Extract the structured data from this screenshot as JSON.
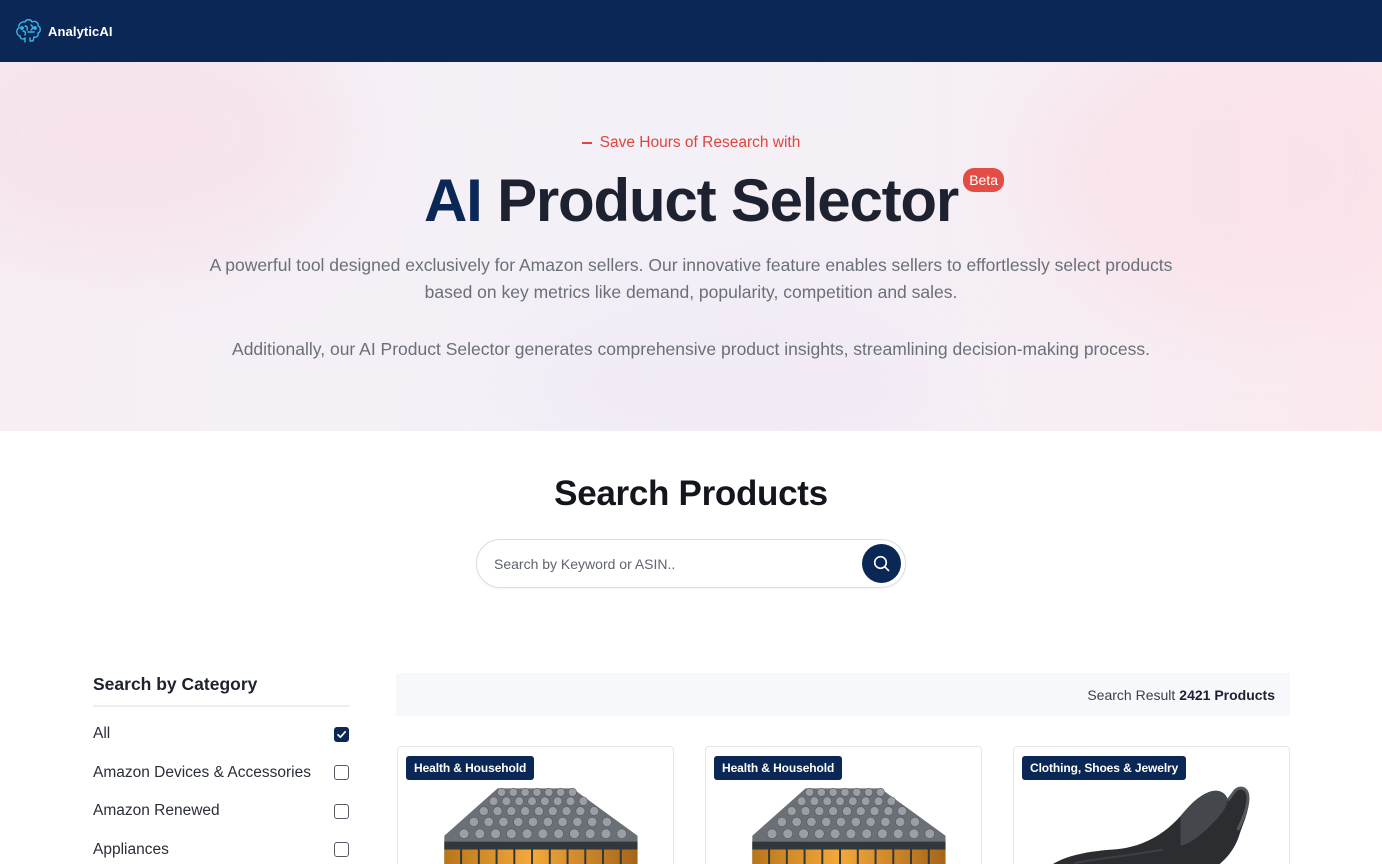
{
  "nav": {
    "brand_name": "AnalyticAI",
    "logo_icon": "brain-logo-icon"
  },
  "hero": {
    "tagline": "Save Hours of Research with",
    "title_accent": "AI",
    "title_rest": "Product Selector",
    "badge": "Beta",
    "description_1": "A powerful tool designed exclusively for Amazon sellers. Our innovative feature enables sellers to effortlessly select products based on key metrics like demand, popularity, competition and sales.",
    "description_2": "Additionally, our AI Product Selector generates comprehensive product insights, streamlining decision-making process."
  },
  "search": {
    "title": "Search Products",
    "placeholder": "Search by Keyword or ASIN..",
    "button_icon": "search-icon"
  },
  "sidebar": {
    "title": "Search by Category",
    "items": [
      {
        "label": "All",
        "checked": true
      },
      {
        "label": "Amazon Devices & Accessories",
        "checked": false
      },
      {
        "label": "Amazon Renewed",
        "checked": false
      },
      {
        "label": "Appliances",
        "checked": false
      }
    ]
  },
  "results": {
    "label": "Search Result",
    "count": "2421 Products"
  },
  "products": [
    {
      "category": "Health & Household",
      "image": "batteries-image"
    },
    {
      "category": "Health & Household",
      "image": "batteries-image"
    },
    {
      "category": "Clothing, Shoes & Jewelry",
      "image": "clog-shoe-image"
    }
  ],
  "colors": {
    "navy": "#0b2756",
    "accent_red": "#e0443c",
    "beta_red": "#e44c46"
  }
}
